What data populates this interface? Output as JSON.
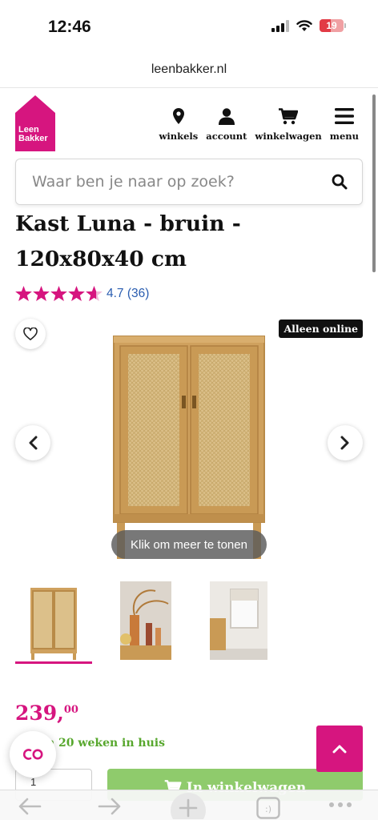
{
  "status_bar": {
    "time": "12:46",
    "battery": "19"
  },
  "browser": {
    "url": "leenbakker.nl"
  },
  "header": {
    "logo_line1": "Leen",
    "logo_line2": "Bakker",
    "nav": [
      {
        "label": "winkels",
        "icon": "map-pin-icon"
      },
      {
        "label": "account",
        "icon": "user-icon"
      },
      {
        "label": "winkelwagen",
        "icon": "cart-icon"
      },
      {
        "label": "menu",
        "icon": "hamburger-icon"
      }
    ]
  },
  "search": {
    "placeholder": "Waar ben je naar op zoek?"
  },
  "product": {
    "title": "Kast Luna - bruin - 120x80x40 cm",
    "rating": 4.7,
    "rating_text": "4.7 (36)",
    "badge": "Alleen online",
    "more_label": "Klik om meer te tonen",
    "price_whole": "239,",
    "price_cents": "00",
    "delivery": "n 20 weken in huis",
    "quantity": "1",
    "cart_label": "In winkelwagen"
  },
  "colors": {
    "brand_pink": "#d6157f",
    "link_blue": "#2a5db0",
    "green": "#57a72d",
    "cart_green": "#8fcb6c"
  }
}
